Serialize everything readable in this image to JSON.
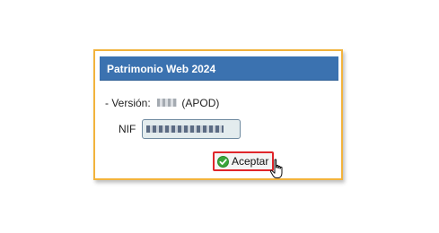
{
  "dialog": {
    "title": "Patrimonio Web 2024",
    "version_prefix": "- Versión:",
    "version_suffix": "(APOD)",
    "nif_label": "NIF",
    "accept_label": "Aceptar"
  },
  "icons": {
    "accept": "check-circle-icon",
    "cursor": "hand-pointer-icon"
  },
  "colors": {
    "titlebar": "#3b72b0",
    "dialog_border": "#f2b33c",
    "accept_highlight": "#e0262b",
    "check_green": "#3aa53a"
  }
}
